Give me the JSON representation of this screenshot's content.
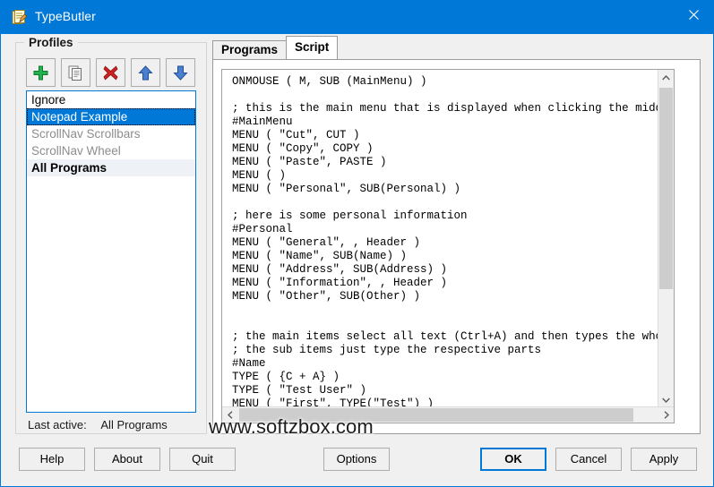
{
  "window": {
    "title": "TypeButler",
    "icon": "app-document-pencil-icon",
    "close_label": "✕",
    "titlebar_color": "#0078d7",
    "background_color": "#f0f0f0"
  },
  "profiles": {
    "group_title": "Profiles",
    "toolbar": [
      {
        "name": "add-profile-button",
        "icon": "plus-icon",
        "color": "#22b14c"
      },
      {
        "name": "duplicate-profile-button",
        "icon": "copy-pages-icon",
        "color": "#8a8a8a"
      },
      {
        "name": "delete-profile-button",
        "icon": "red-x-icon",
        "color": "#cc2222"
      },
      {
        "name": "move-up-button",
        "icon": "arrow-up-icon",
        "color": "#3a6fc4"
      },
      {
        "name": "move-down-button",
        "icon": "arrow-down-icon",
        "color": "#3a6fc4"
      }
    ],
    "items": [
      {
        "label": "Ignore",
        "state": "normal"
      },
      {
        "label": "Notepad Example",
        "state": "selected"
      },
      {
        "label": "ScrollNav Scrollbars",
        "state": "disabled"
      },
      {
        "label": "ScrollNav Wheel",
        "state": "disabled"
      },
      {
        "label": "All Programs",
        "state": "bold"
      }
    ],
    "last_active_label": "Last active:",
    "last_active_value": "All Programs"
  },
  "tabs": [
    {
      "label": "Programs",
      "active": false
    },
    {
      "label": "Script",
      "active": true
    }
  ],
  "editor": {
    "content": "ONMOUSE ( M, SUB (MainMenu) )\n\n; this is the main menu that is displayed when clicking the middle m\n#MainMenu\nMENU ( \"Cut\", CUT )\nMENU ( \"Copy\", COPY )\nMENU ( \"Paste\", PASTE )\nMENU ( )\nMENU ( \"Personal\", SUB(Personal) )\n\n; here is some personal information\n#Personal\nMENU ( \"General\", , Header )\nMENU ( \"Name\", SUB(Name) )\nMENU ( \"Address\", SUB(Address) )\nMENU ( \"Information\", , Header )\nMENU ( \"Other\", SUB(Other) )\n\n\n; the main items select all text (Ctrl+A) and then types the whole n\n; the sub items just type the respective parts\n#Name\nTYPE ( {C + A} )\nTYPE ( \"Test User\" )\nMENU ( \"First\", TYPE(\"Test\") )",
    "vscroll_up_glyph": "⌃",
    "vscroll_down_glyph": "⌄",
    "hscroll_left_glyph": "‹",
    "hscroll_right_glyph": "›"
  },
  "buttons": {
    "help": "Help",
    "about": "About",
    "quit": "Quit",
    "options": "Options",
    "ok": "OK",
    "cancel": "Cancel",
    "apply": "Apply"
  },
  "watermark": "www.softzbox.com"
}
